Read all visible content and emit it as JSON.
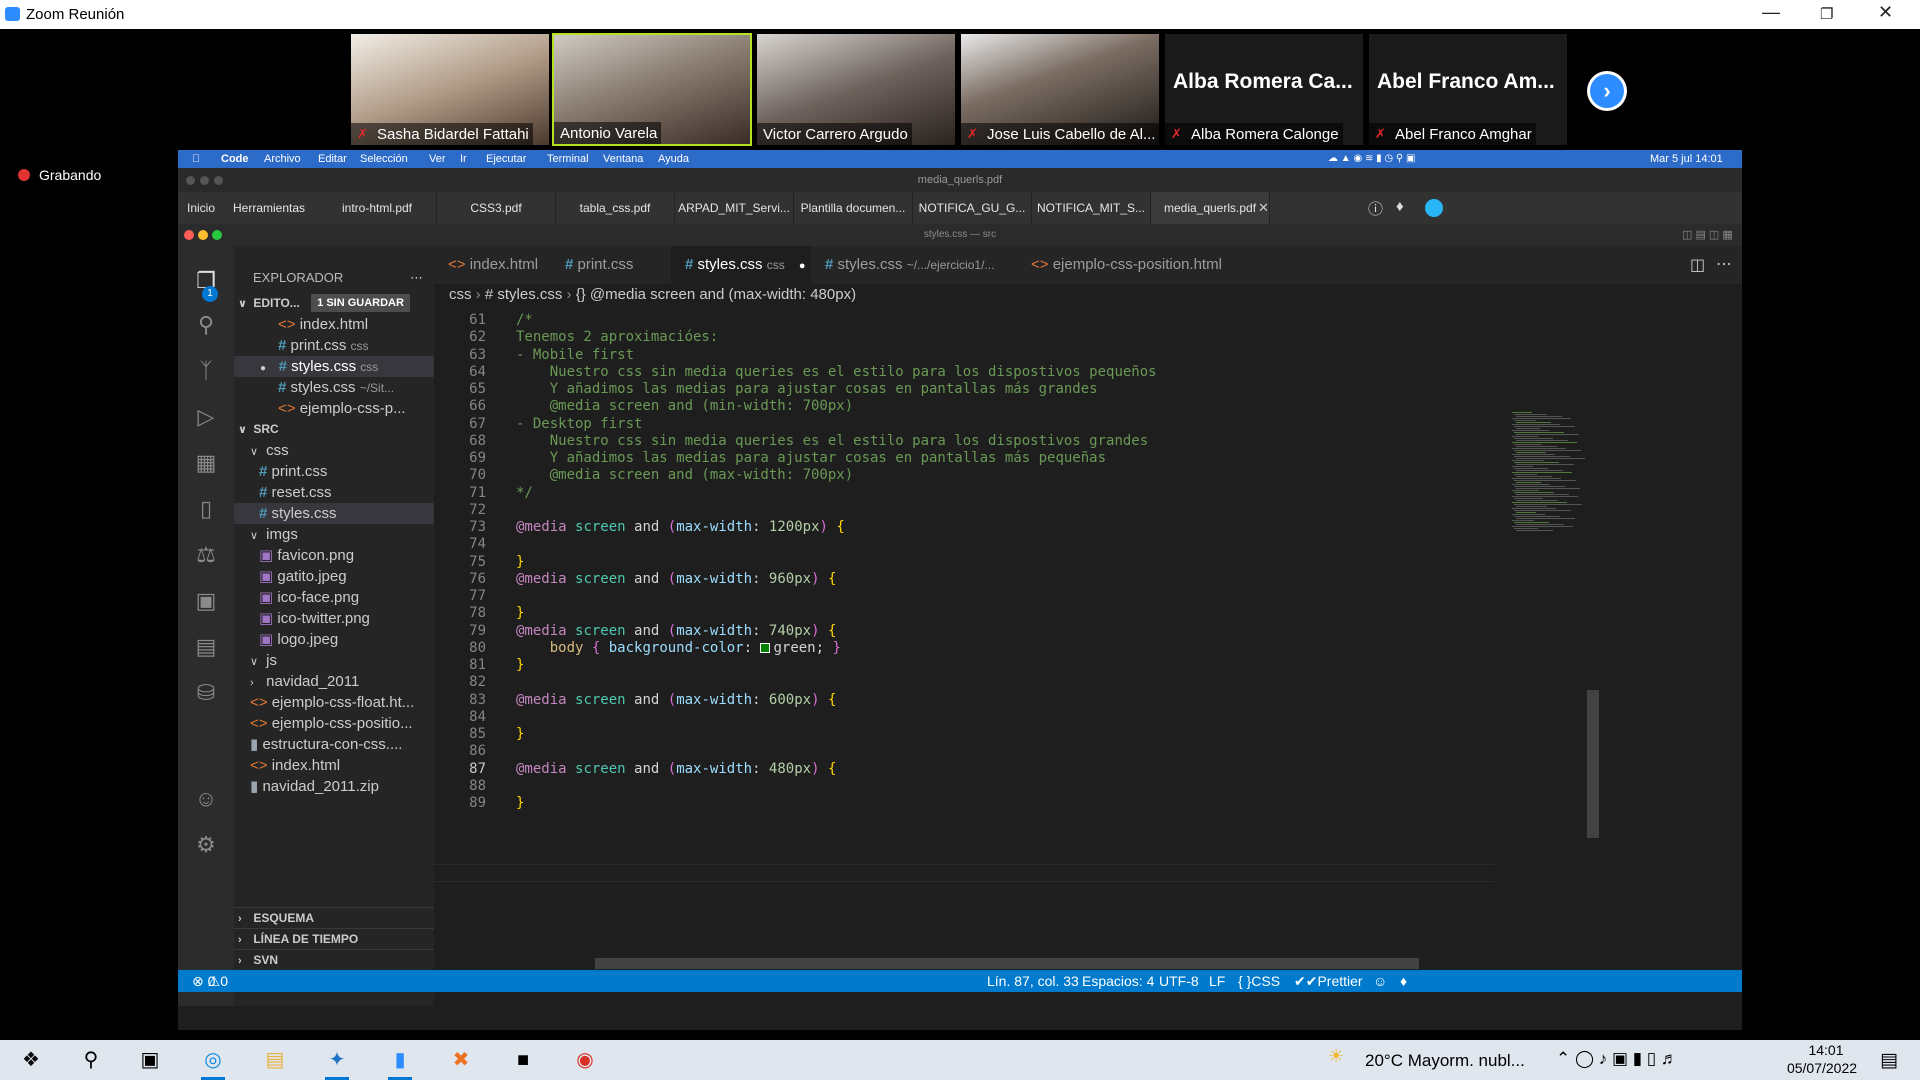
{
  "zoom": {
    "window_title": "Zoom Reunión",
    "recording_label": "Grabando",
    "participants": [
      {
        "name": "Sasha Bidardel Fattahi",
        "muted": true
      },
      {
        "name": "Antonio Varela",
        "muted": false
      },
      {
        "name": "Victor Carrero Argudo",
        "muted": false
      },
      {
        "name": "Jose Luis Cabello de Al...",
        "muted": true
      },
      {
        "name": "Alba Romera Calonge",
        "big_name": "Alba Romera Ca...",
        "muted": true
      },
      {
        "name": "Abel Franco Amghar",
        "big_name": "Abel Franco Am...",
        "muted": true
      }
    ]
  },
  "mac": {
    "menu": [
      "Code",
      "Archivo",
      "Editar",
      "Selección",
      "Ver",
      "Ir",
      "Ejecutar",
      "Terminal",
      "Ventana",
      "Ayuda"
    ],
    "clock": "Mar 5 jul  14:01",
    "pdf_window_title": "media_querls.pdf",
    "pdf_nav": [
      "Inicio",
      "Herramientas"
    ],
    "pdf_tabs": [
      "intro-html.pdf",
      "CSS3.pdf",
      "tabla_css.pdf",
      "ARPAD_MIT_Servi...",
      "Plantilla documen...",
      "NOTIFICA_GU_G...",
      "NOTIFICA_MIT_S...",
      "media_querls.pdf"
    ],
    "vscode_title": "styles.css — src"
  },
  "vscode": {
    "explorer_title": "EXPLORADOR",
    "open_editors": {
      "label": "EDITO...",
      "badge": "1 SIN GUARDAR",
      "items": [
        {
          "icon": "html",
          "name": "index.html",
          "hint": ""
        },
        {
          "icon": "css",
          "name": "print.css",
          "hint": "css"
        },
        {
          "icon": "css",
          "name": "styles.css",
          "hint": "css",
          "modified": true
        },
        {
          "icon": "css",
          "name": "styles.css",
          "hint": "~/Sit..."
        },
        {
          "icon": "html",
          "name": "ejemplo-css-p...",
          "hint": ""
        }
      ]
    },
    "src": {
      "label": "SRC",
      "tree": [
        {
          "kind": "folder",
          "name": "css",
          "depth": 1
        },
        {
          "kind": "css",
          "name": "print.css",
          "depth": 2
        },
        {
          "kind": "css",
          "name": "reset.css",
          "depth": 2
        },
        {
          "kind": "css",
          "name": "styles.css",
          "depth": 2,
          "selected": true
        },
        {
          "kind": "folder",
          "name": "imgs",
          "depth": 1
        },
        {
          "kind": "img",
          "name": "favicon.png",
          "depth": 2
        },
        {
          "kind": "img",
          "name": "gatito.jpeg",
          "depth": 2
        },
        {
          "kind": "img",
          "name": "ico-face.png",
          "depth": 2
        },
        {
          "kind": "img",
          "name": "ico-twitter.png",
          "depth": 2
        },
        {
          "kind": "img",
          "name": "logo.jpeg",
          "depth": 2
        },
        {
          "kind": "folder",
          "name": "js",
          "depth": 1
        },
        {
          "kind": "folder-closed",
          "name": "navidad_2011",
          "depth": 1
        },
        {
          "kind": "html",
          "name": "ejemplo-css-float.ht...",
          "depth": 1
        },
        {
          "kind": "html",
          "name": "ejemplo-css-positio...",
          "depth": 1
        },
        {
          "kind": "zip",
          "name": "estructura-con-css....",
          "depth": 1
        },
        {
          "kind": "html",
          "name": "index.html",
          "depth": 1
        },
        {
          "kind": "zip",
          "name": "navidad_2011.zip",
          "depth": 1
        }
      ]
    },
    "bottom_sections": [
      "ESQUEMA",
      "LÍNEA DE TIEMPO",
      "SVN"
    ],
    "tabs": [
      {
        "icon": "html",
        "label": "index.html",
        "sub": ""
      },
      {
        "icon": "css",
        "label": "print.css",
        "sub": ""
      },
      {
        "icon": "css",
        "label": "styles.css",
        "sub": "css",
        "active": true,
        "dirty": true
      },
      {
        "icon": "css",
        "label": "styles.css",
        "sub": "~/.../ejercicio1/..."
      },
      {
        "icon": "html",
        "label": "ejemplo-css-position.html",
        "sub": ""
      }
    ],
    "breadcrumb": [
      "css",
      "# styles.css",
      "{} @media screen and (max-width: 480px)"
    ],
    "code_lines": [
      {
        "n": 61,
        "t": "/*"
      },
      {
        "n": 62,
        "t": "Tenemos 2 aproximacióes:"
      },
      {
        "n": 63,
        "t": "- Mobile first"
      },
      {
        "n": 64,
        "t": "    Nuestro css sin media queries es el estilo para los dispostivos pequeños"
      },
      {
        "n": 65,
        "t": "    Y añadimos las medias para ajustar cosas en pantallas más grandes"
      },
      {
        "n": 66,
        "t": "    @media screen and (min-width: 700px)"
      },
      {
        "n": 67,
        "t": "- Desktop first"
      },
      {
        "n": 68,
        "t": "    Nuestro css sin media queries es el estilo para los dispostivos grandes"
      },
      {
        "n": 69,
        "t": "    Y añadimos las medias para ajustar cosas en pantallas más pequeñas"
      },
      {
        "n": 70,
        "t": "    @media screen and (max-width: 700px)"
      },
      {
        "n": 71,
        "t": "*/"
      },
      {
        "n": 72,
        "t": ""
      },
      {
        "n": 73,
        "t": "@media screen and (max-width: 1200px) {"
      },
      {
        "n": 74,
        "t": ""
      },
      {
        "n": 75,
        "t": "}"
      },
      {
        "n": 76,
        "t": "@media screen and (max-width: 960px) {"
      },
      {
        "n": 77,
        "t": ""
      },
      {
        "n": 78,
        "t": "}"
      },
      {
        "n": 79,
        "t": "@media screen and (max-width: 740px) {"
      },
      {
        "n": 80,
        "t": "    body { background-color: green; }"
      },
      {
        "n": 81,
        "t": "}"
      },
      {
        "n": 82,
        "t": ""
      },
      {
        "n": 83,
        "t": "@media screen and (max-width: 600px) {"
      },
      {
        "n": 84,
        "t": ""
      },
      {
        "n": 85,
        "t": "}"
      },
      {
        "n": 86,
        "t": ""
      },
      {
        "n": 87,
        "t": "@media screen and (max-width: 480px) {",
        "current": true
      },
      {
        "n": 88,
        "t": ""
      },
      {
        "n": 89,
        "t": "}"
      }
    ],
    "status": {
      "errors": "0",
      "warnings": "0",
      "position": "Lín. 87, col. 33",
      "spaces": "Espacios: 4",
      "encoding": "UTF-8",
      "eol": "LF",
      "language": "CSS",
      "formatter": "Prettier"
    }
  },
  "taskbar": {
    "weather": "20°C  Mayorm. nubl...",
    "time": "14:01",
    "date": "05/07/2022"
  }
}
